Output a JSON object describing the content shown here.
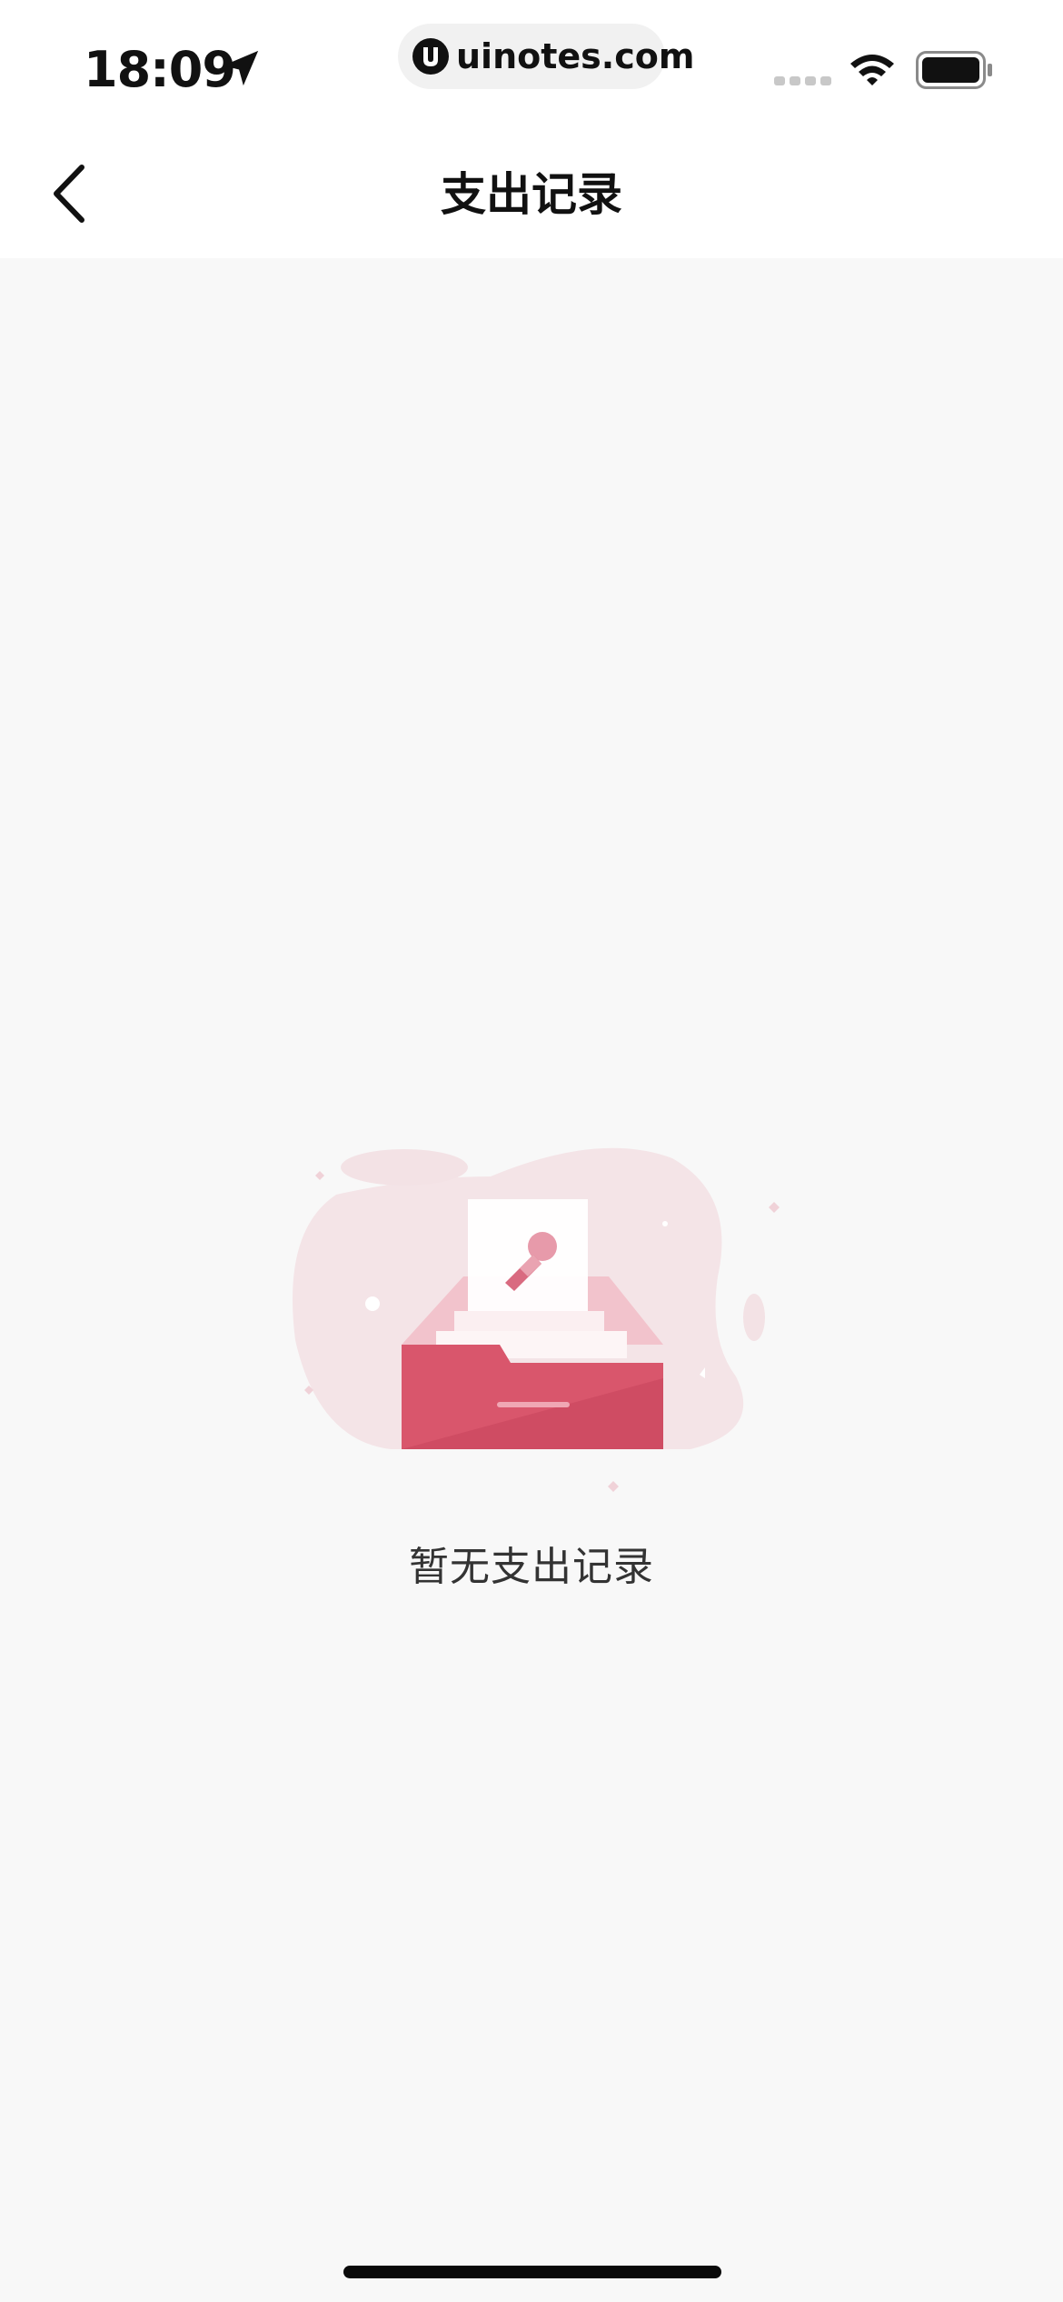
{
  "status_bar": {
    "time": "18:09",
    "url": "uinotes.com",
    "icons": [
      "location-arrow-icon",
      "site-logo-icon",
      "signal-icon",
      "wifi-icon",
      "battery-icon"
    ]
  },
  "nav": {
    "title": "支出记录",
    "back_icon": "chevron-left-icon"
  },
  "empty_state": {
    "message": "暂无支出记录",
    "illustration": "empty-drawer-illustration"
  },
  "colors": {
    "background": "#f8f8f8",
    "header": "#ffffff",
    "accent": "#d64b63",
    "blob": "#f4e4e7"
  }
}
